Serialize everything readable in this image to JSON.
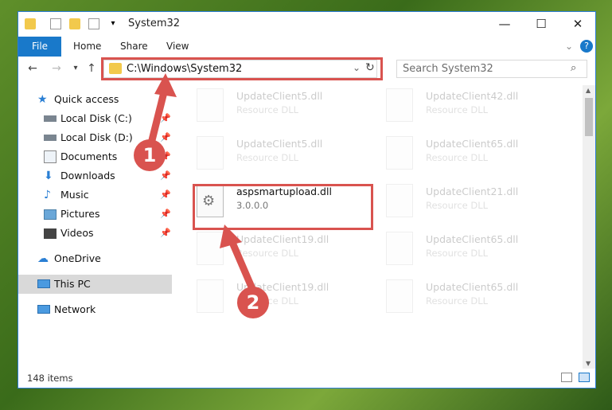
{
  "window": {
    "title": "System32",
    "controls": [
      "—",
      "☐",
      "✕"
    ]
  },
  "ribbon": {
    "tabs": [
      "File",
      "Home",
      "Share",
      "View"
    ]
  },
  "address": {
    "path": "C:\\Windows\\System32",
    "search_placeholder": "Search System32"
  },
  "sidebar": {
    "items": [
      {
        "label": "Quick access",
        "icon": "star-icon"
      },
      {
        "label": "Local Disk (C:)",
        "icon": "drive-icon"
      },
      {
        "label": "Local Disk (D:)",
        "icon": "drive-icon"
      },
      {
        "label": "Documents",
        "icon": "documents-icon"
      },
      {
        "label": "Downloads",
        "icon": "download-icon"
      },
      {
        "label": "Music",
        "icon": "music-icon"
      },
      {
        "label": "Pictures",
        "icon": "pictures-icon"
      },
      {
        "label": "Videos",
        "icon": "videos-icon"
      },
      {
        "label": "OneDrive",
        "icon": "cloud-icon"
      },
      {
        "label": "This PC",
        "icon": "computer-icon"
      },
      {
        "label": "Network",
        "icon": "network-icon"
      }
    ]
  },
  "files": [
    {
      "name": "UpdateClient5.dll",
      "desc": "Resource DLL"
    },
    {
      "name": "UpdateClient42.dll",
      "desc": "Resource DLL"
    },
    {
      "name": "UpdateClient5.dll",
      "desc": "Resource DLL"
    },
    {
      "name": "UpdateClient65.dll",
      "desc": "Resource DLL"
    },
    {
      "name": "aspsmartupload.dll",
      "desc": "3.0.0.0"
    },
    {
      "name": "UpdateClient21.dll",
      "desc": "Resource DLL"
    },
    {
      "name": "UpdateClient19.dll",
      "desc": "Resource DLL"
    },
    {
      "name": "UpdateClient65.dll",
      "desc": "Resource DLL"
    },
    {
      "name": "UpdateClient19.dll",
      "desc": "Resource DLL"
    },
    {
      "name": "UpdateClient65.dll",
      "desc": "Resource DLL"
    }
  ],
  "status": {
    "count": "148 items"
  },
  "markers": [
    "1",
    "2"
  ],
  "colors": {
    "accent": "#1979ca",
    "highlight": "#d9534f",
    "selected": "#d9d9d9"
  }
}
